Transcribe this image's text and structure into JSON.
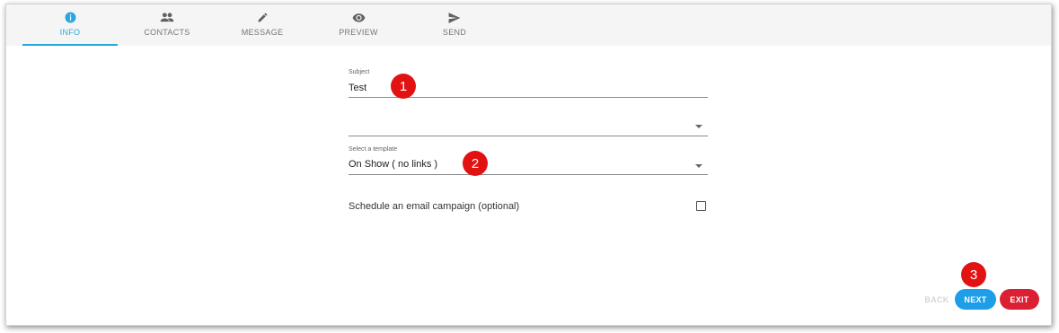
{
  "tabs": [
    {
      "label": "INFO",
      "icon": "info-icon",
      "active": true
    },
    {
      "label": "CONTACTS",
      "icon": "people-icon",
      "active": false
    },
    {
      "label": "MESSAGE",
      "icon": "pencil-icon",
      "active": false
    },
    {
      "label": "PREVIEW",
      "icon": "eye-icon",
      "active": false
    },
    {
      "label": "SEND",
      "icon": "send-icon",
      "active": false
    }
  ],
  "form": {
    "subject": {
      "label": "Subject",
      "value": "Test"
    },
    "dropdown1": {
      "value": ""
    },
    "template": {
      "label": "Select a template",
      "value": "On Show ( no links )"
    },
    "schedule": {
      "label": "Schedule an email campaign (optional)",
      "checked": false
    }
  },
  "callouts": [
    "1",
    "2",
    "3"
  ],
  "actions": {
    "back_label": "BACK",
    "next_label": "NEXT",
    "exit_label": "EXIT"
  },
  "colors": {
    "accent": "#29a8e0",
    "next": "#1e9ee8",
    "exit": "#dc2033",
    "callout": "#e21212"
  }
}
